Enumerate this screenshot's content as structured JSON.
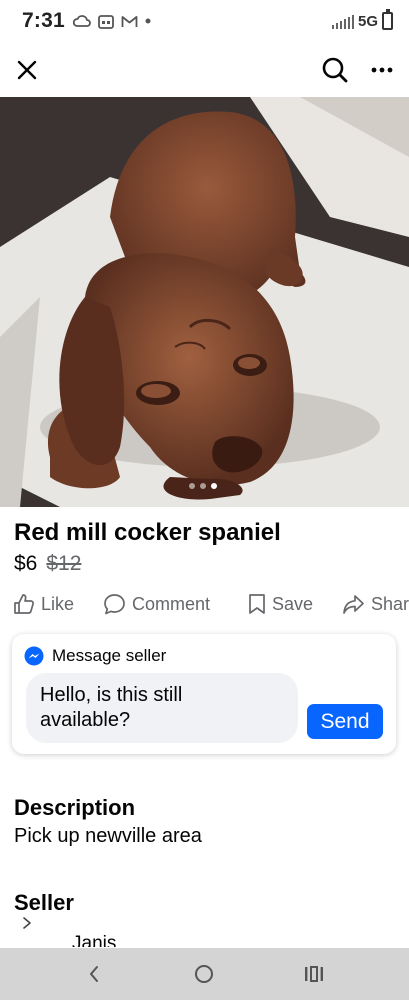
{
  "status_bar": {
    "time": "7:31",
    "network": "5G"
  },
  "listing": {
    "title": "Red mill cocker spaniel",
    "price": "$6",
    "original_price": "$12",
    "photo_count": 3,
    "active_photo": 3
  },
  "actions": {
    "like": "Like",
    "comment": "Comment",
    "save": "Save",
    "share": "Shar"
  },
  "message_card": {
    "heading": "Message seller",
    "input_line1": "Hello, is this still",
    "input_line2": "available?",
    "send": "Send"
  },
  "description": {
    "heading": "Description",
    "text": "Pick up newville area"
  },
  "seller": {
    "heading": "Seller",
    "name": "Janis"
  },
  "colors": {
    "accent": "#0866ff",
    "muted_text": "#65676b",
    "input_bg": "#f0f2f5",
    "nav_bar": "#d4d4d4"
  }
}
